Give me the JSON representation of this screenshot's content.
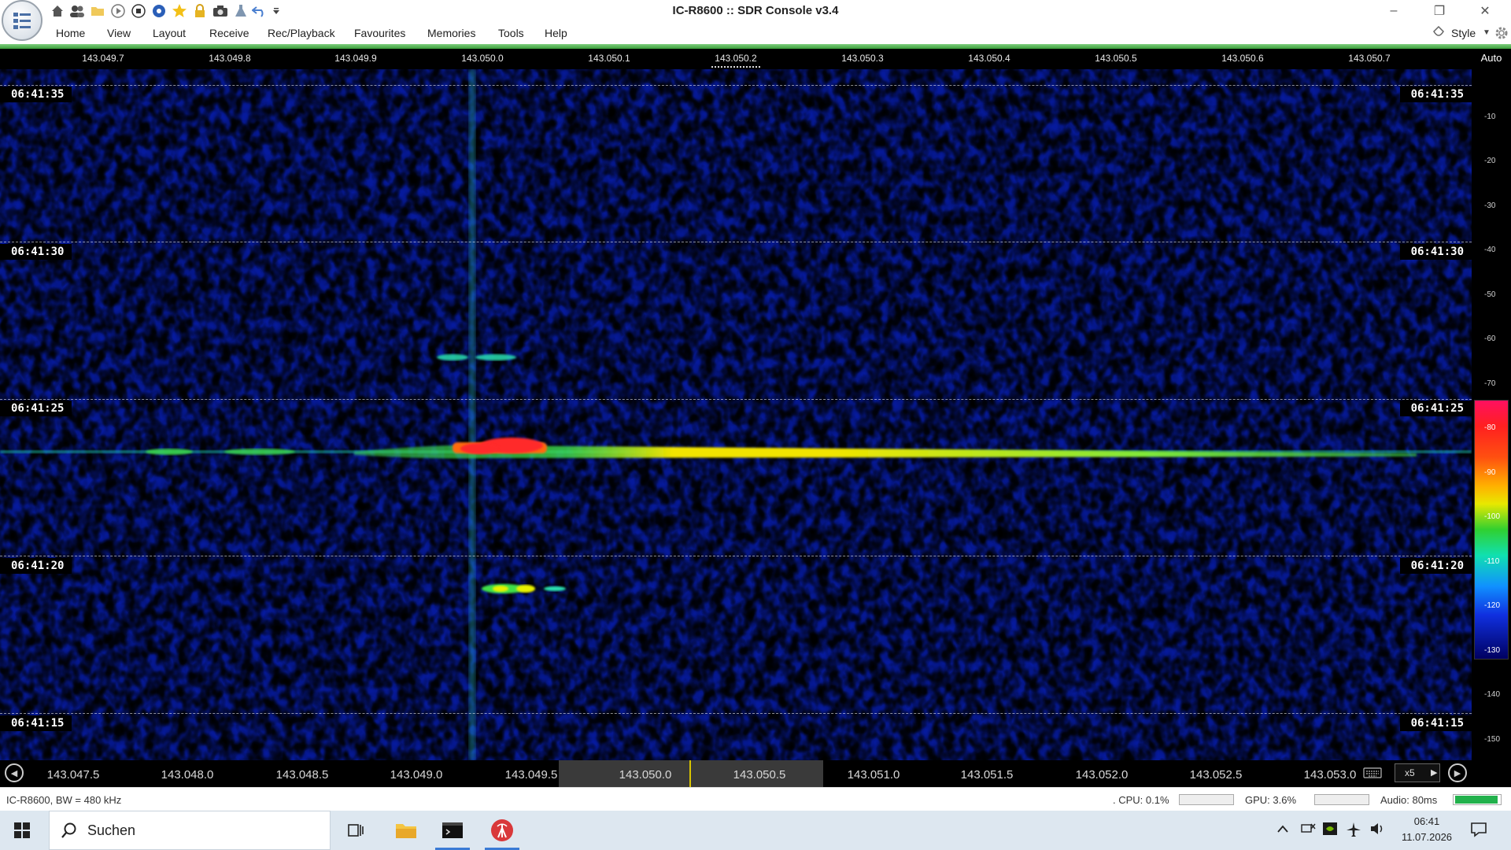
{
  "window": {
    "title": "IC-R8600 :: SDR Console v3.4",
    "minimize": "–",
    "restore": "❐",
    "close": "✕"
  },
  "quick_access_icons": [
    "home-icon",
    "users-icon",
    "folder-icon",
    "play-icon",
    "stop-icon",
    "record-icon",
    "favourite-star-icon",
    "lock-icon",
    "camera-icon",
    "flask-icon",
    "undo-icon",
    "customize-arrow-icon"
  ],
  "menu": [
    "Home",
    "View",
    "Layout",
    "Receive",
    "Rec/Playback",
    "Favourites",
    "Memories",
    "Tools",
    "Help"
  ],
  "style_label": "Style",
  "top_ruler": {
    "ticks": [
      "143.049.7",
      "143.049.8",
      "143.049.9",
      "143.050.0",
      "143.050.1",
      "143.050.2",
      "143.050.3",
      "143.050.4",
      "143.050.5",
      "143.050.6",
      "143.050.7"
    ],
    "auto_label": "Auto"
  },
  "waterfall": {
    "time_labels": [
      "06:41:35",
      "06:41:30",
      "06:41:25",
      "06:41:20",
      "06:41:15"
    ]
  },
  "db_scale": [
    "-10",
    "-20",
    "-30",
    "-40",
    "-50",
    "-60",
    "-70",
    "-80",
    "-90",
    "-100",
    "-110",
    "-120",
    "-130",
    "-140",
    "-150"
  ],
  "bottom_bar": {
    "ticks": [
      "143.047.5",
      "143.048.0",
      "143.048.5",
      "143.049.0",
      "143.049.5",
      "143.050.0",
      "143.050.5",
      "143.051.0",
      "143.051.5",
      "143.052.0",
      "143.052.5",
      "143.053.0"
    ],
    "zoom": "x5"
  },
  "status": {
    "device": "IC-R8600, BW = 480 kHz",
    "cpu": ". CPU: 0.1%",
    "gpu": "GPU: 3.6%",
    "audio": "Audio: 80ms"
  },
  "taskbar": {
    "search_placeholder": "Suchen",
    "time": "06:41",
    "date": "11.07.2026"
  },
  "colors": {
    "noise_low": "#061a9c",
    "noise_mid": "#1f6cf0",
    "noise_high": "#2fd4e8",
    "signal_green": "#3fe04a",
    "signal_yellow": "#f2e400",
    "signal_red": "#ff2a2a",
    "accent_green": "#3a9d3a"
  }
}
